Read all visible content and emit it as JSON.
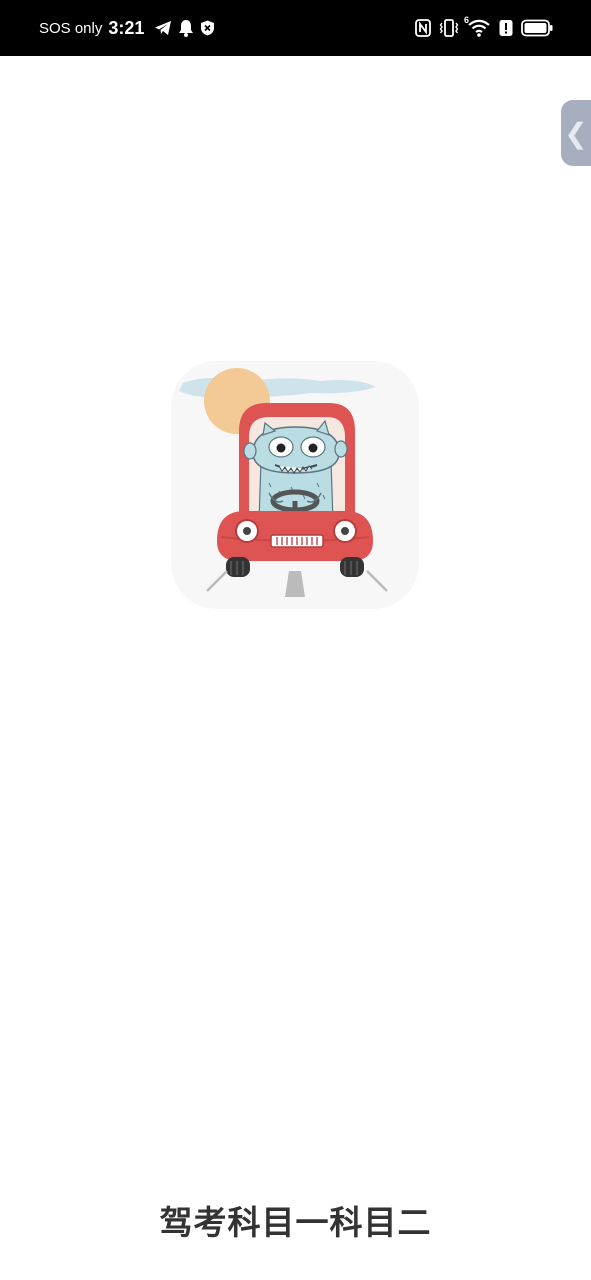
{
  "status_bar": {
    "carrier": "SOS only",
    "time": "3:21",
    "left_icons": [
      "telegram-icon",
      "bell-icon",
      "shield-icon"
    ],
    "right_icons": [
      "nfc-icon",
      "vibrate-icon",
      "wifi-icon",
      "alert-icon",
      "battery-icon"
    ],
    "wifi_badge": "6"
  },
  "splash": {
    "app_name": "驾考科目一科目二",
    "icon": "car-monster-icon"
  },
  "edge_handle": {
    "glyph": "❮"
  }
}
